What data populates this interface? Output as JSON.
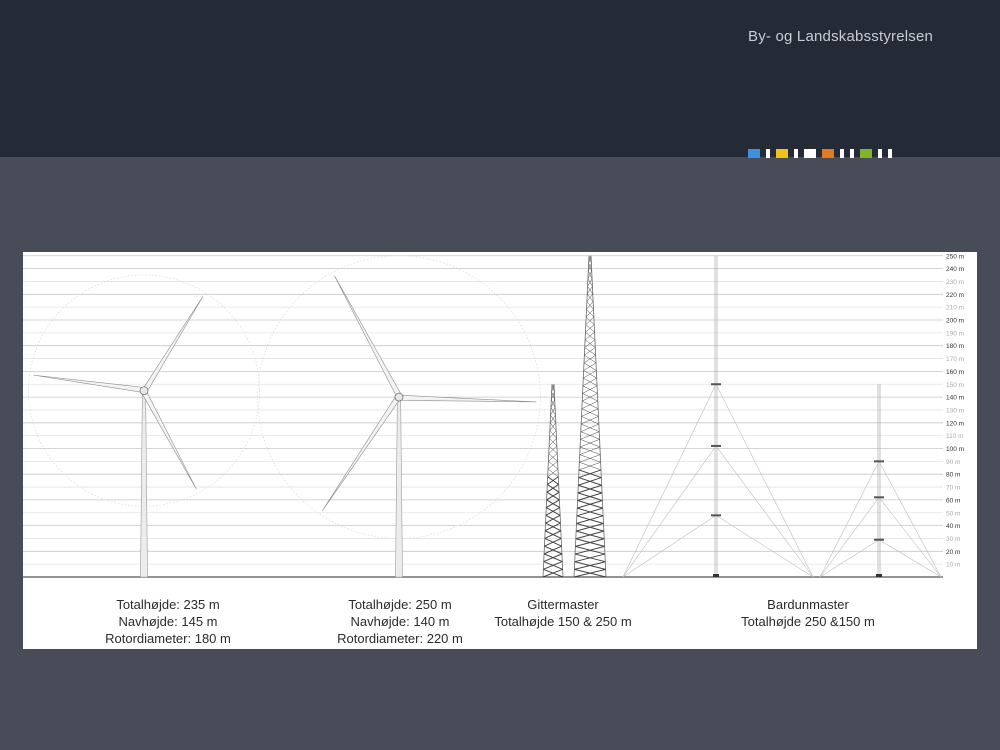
{
  "header": {
    "organization": "By- og Landskabsstyrelsen",
    "brand_marks": [
      {
        "color": "#3d8fe0",
        "kind": "square"
      },
      {
        "color": "#ffffff",
        "kind": "bar"
      },
      {
        "color": "#f3c21a",
        "kind": "square"
      },
      {
        "color": "#ffffff",
        "kind": "bar"
      },
      {
        "color": "#ffffff",
        "kind": "square"
      },
      {
        "color": "#e07b1f",
        "kind": "square"
      },
      {
        "color": "#ffffff",
        "kind": "bar"
      },
      {
        "color": "#ffffff",
        "kind": "bar"
      },
      {
        "color": "#7fb52b",
        "kind": "square"
      },
      {
        "color": "#ffffff",
        "kind": "bar"
      },
      {
        "color": "#ffffff",
        "kind": "bar"
      }
    ]
  },
  "diagram": {
    "scale": {
      "min": 0,
      "max": 250,
      "step": 10,
      "ticks": [
        "10 m",
        "20 m",
        "30 m",
        "40 m",
        "50 m",
        "60 m",
        "70 m",
        "80 m",
        "90 m",
        "100 m",
        "110 m",
        "120 m",
        "130 m",
        "140 m",
        "150 m",
        "160 m",
        "170 m",
        "180 m",
        "190 m",
        "200 m",
        "210 m",
        "220 m",
        "230 m",
        "240 m",
        "250 m"
      ],
      "emphasized_every": 20
    },
    "turbines": [
      {
        "total_height_m": 235,
        "hub_height_m": 145,
        "rotor_diameter_m": 180,
        "caption": [
          "Totalhøjde: 235 m",
          "Navhøjde: 145 m",
          "Rotordiameter: 180 m"
        ]
      },
      {
        "total_height_m": 250,
        "hub_height_m": 140,
        "rotor_diameter_m": 220,
        "caption": [
          "Totalhøjde: 250 m",
          "Navhøjde: 140 m",
          "Rotordiameter: 220 m"
        ]
      }
    ],
    "lattice_masts": {
      "heights_m": [
        150,
        250
      ],
      "caption": [
        "Gittermaster",
        "Totalhøjde 150 & 250 m"
      ]
    },
    "guyed_masts": {
      "heights_m": [
        250,
        150
      ],
      "guy_levels_m": [
        [
          150,
          102,
          48
        ],
        [
          90,
          62,
          29
        ]
      ],
      "caption": [
        "Bardunmaster",
        "Totalhøjde 250 &150 m"
      ]
    }
  }
}
